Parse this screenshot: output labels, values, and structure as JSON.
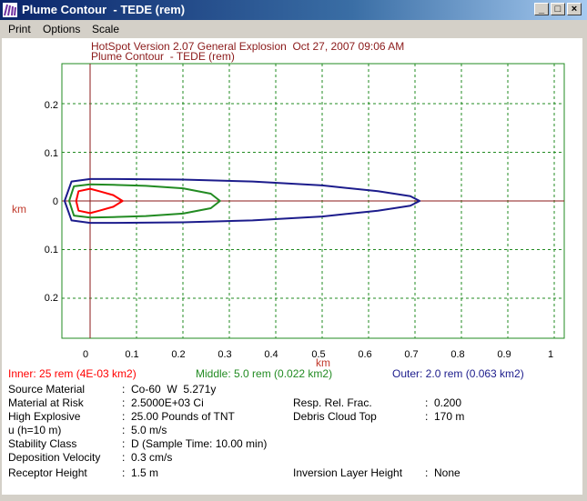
{
  "window": {
    "title": "Plume Contour  - TEDE (rem)",
    "minimize": "_",
    "maximize": "□",
    "close": "×"
  },
  "menu": [
    {
      "label": "Print"
    },
    {
      "label": "Options"
    },
    {
      "label": "Scale"
    }
  ],
  "header": {
    "line1": "HotSpot Version 2.07 General Explosion  Oct 27, 2007 09:06 AM",
    "line2": "Plume Contour  - TEDE (rem)"
  },
  "chart_data": {
    "type": "line",
    "xlabel": "km",
    "ylabel": "km",
    "xlim": [
      -0.06,
      1.0
    ],
    "ylim": [
      -0.28,
      0.28
    ],
    "grid": true,
    "x_ticks": [
      "0",
      "0.1",
      "0.2",
      "0.3",
      "0.4",
      "0.5",
      "0.6",
      "0.7",
      "0.8",
      "0.9",
      "1"
    ],
    "y_ticks": [
      "0.2",
      "0.1",
      "0",
      "0.1",
      "0.2"
    ],
    "series": [
      {
        "name": "Inner: 25 rem (4E-03 km2)",
        "color": "#ff0000",
        "points": [
          [
            0.07,
            0
          ],
          [
            0.05,
            0.012
          ],
          [
            0.02,
            0.02
          ],
          [
            0.0,
            0.025
          ],
          [
            -0.025,
            0.02
          ],
          [
            -0.03,
            0
          ],
          [
            -0.025,
            -0.02
          ],
          [
            0.0,
            -0.025
          ],
          [
            0.02,
            -0.02
          ],
          [
            0.05,
            -0.012
          ],
          [
            0.07,
            0
          ]
        ]
      },
      {
        "name": "Middle: 5.0 rem (0.022 km2)",
        "color": "#228b22",
        "points": [
          [
            0.28,
            0
          ],
          [
            0.26,
            0.015
          ],
          [
            0.2,
            0.026
          ],
          [
            0.12,
            0.031
          ],
          [
            0.05,
            0.033
          ],
          [
            0.0,
            0.034
          ],
          [
            -0.035,
            0.03
          ],
          [
            -0.045,
            0
          ],
          [
            -0.035,
            -0.03
          ],
          [
            0.0,
            -0.034
          ],
          [
            0.05,
            -0.033
          ],
          [
            0.12,
            -0.031
          ],
          [
            0.2,
            -0.026
          ],
          [
            0.26,
            -0.015
          ],
          [
            0.28,
            0
          ]
        ]
      },
      {
        "name": "Outer: 2.0 rem (0.063 km2)",
        "color": "#1c1c8c",
        "points": [
          [
            0.71,
            0
          ],
          [
            0.69,
            0.01
          ],
          [
            0.62,
            0.02
          ],
          [
            0.5,
            0.032
          ],
          [
            0.35,
            0.04
          ],
          [
            0.2,
            0.044
          ],
          [
            0.05,
            0.045
          ],
          [
            0.0,
            0.045
          ],
          [
            -0.04,
            0.04
          ],
          [
            -0.055,
            0
          ],
          [
            -0.04,
            -0.04
          ],
          [
            0.0,
            -0.045
          ],
          [
            0.05,
            -0.045
          ],
          [
            0.2,
            -0.044
          ],
          [
            0.35,
            -0.04
          ],
          [
            0.5,
            -0.032
          ],
          [
            0.62,
            -0.02
          ],
          [
            0.69,
            -0.01
          ],
          [
            0.71,
            0
          ]
        ]
      }
    ]
  },
  "info": {
    "source_material": {
      "label": "Source Material",
      "value": ":  Co-60  W  5.271y"
    },
    "material_at_risk": {
      "label": "Material at Risk",
      "value": ":  2.5000E+03 Ci"
    },
    "high_explosive": {
      "label": "High Explosive",
      "value": ":  25.00 Pounds of TNT"
    },
    "wind": {
      "label": "u (h=10 m)",
      "value": ":  5.0 m/s"
    },
    "stability": {
      "label": "Stability Class",
      "value": ":  D (Sample Time: 10.00 min)"
    },
    "deposition": {
      "label": "Deposition Velocity",
      "value": ":  0.3 cm/s"
    },
    "receptor": {
      "label": "Receptor Height",
      "value": ":  1.5 m"
    },
    "resp_rel": {
      "label": "Resp. Rel. Frac.",
      "value": ":  0.200"
    },
    "debris": {
      "label": "Debris Cloud Top",
      "value": ":  170 m"
    },
    "inversion": {
      "label": "Inversion Layer Height",
      "value": ":  None"
    }
  },
  "colors": {
    "frame": "#228b22",
    "axis": "#8b1a1a",
    "inner": "#ff0000",
    "middle": "#228b22",
    "outer": "#1c1c8c"
  }
}
